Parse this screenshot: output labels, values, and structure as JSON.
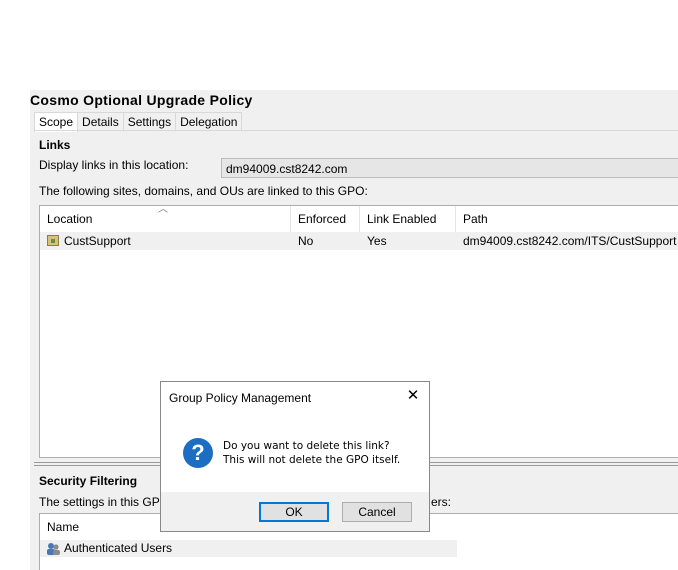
{
  "policy": {
    "title": "Cosmo Optional Upgrade Policy",
    "tabs": [
      "Scope",
      "Details",
      "Settings",
      "Delegation"
    ],
    "active_tab": "Scope"
  },
  "links": {
    "heading": "Links",
    "display_label": "Display links in this location:",
    "location_value": "dm94009.cst8242.com",
    "following_text": "The following sites, domains, and OUs are linked to this GPO:",
    "columns": [
      "Location",
      "Enforced",
      "Link Enabled",
      "Path"
    ],
    "rows": [
      {
        "location": "CustSupport",
        "enforced": "No",
        "link_enabled": "Yes",
        "path": "dm94009.cst8242.com/ITS/CustSupport"
      }
    ]
  },
  "security": {
    "heading": "Security Filtering",
    "desc_left": "The settings in this GPO c",
    "desc_right": "ers:",
    "columns": [
      "Name"
    ],
    "rows": [
      {
        "name": "Authenticated Users"
      }
    ]
  },
  "dialog": {
    "title": "Group Policy Management",
    "close_glyph": "✕",
    "icon_glyph": "?",
    "message_line1": "Do you want to delete this link?",
    "message_line2": "This will not delete the GPO itself.",
    "ok_label": "OK",
    "cancel_label": "Cancel"
  },
  "colors": {
    "accent": "#0078d7",
    "question_icon": "#1b6ec2"
  }
}
